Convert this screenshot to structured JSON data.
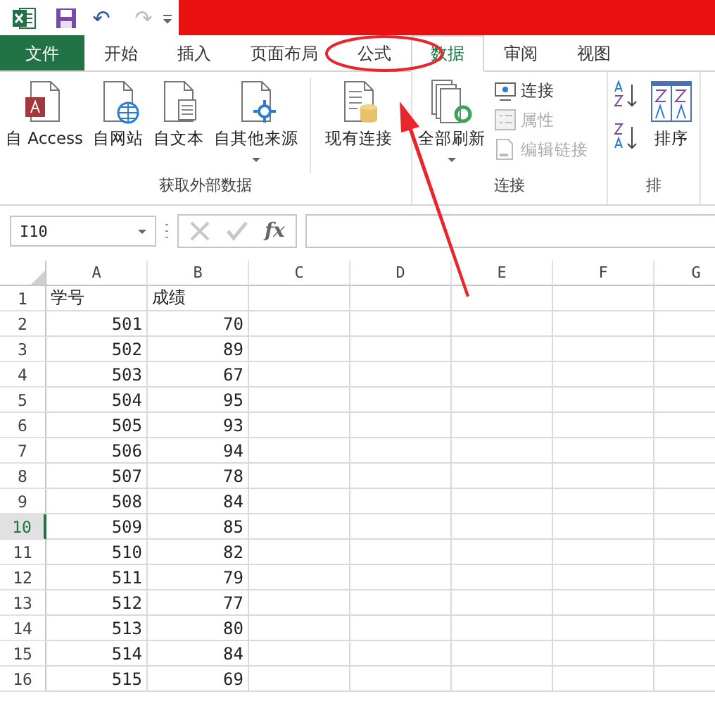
{
  "title_bar": {
    "undo": "↶",
    "redo": "↷"
  },
  "tabs": [
    {
      "label": "文件",
      "kind": "file",
      "selected": false
    },
    {
      "label": "开始",
      "kind": "tab",
      "selected": false
    },
    {
      "label": "插入",
      "kind": "tab",
      "selected": false
    },
    {
      "label": "页面布局",
      "kind": "tab",
      "selected": false
    },
    {
      "label": "公式",
      "kind": "tab",
      "selected": false
    },
    {
      "label": "数据",
      "kind": "tab",
      "selected": true
    },
    {
      "label": "审阅",
      "kind": "tab",
      "selected": false
    },
    {
      "label": "视图",
      "kind": "tab",
      "selected": false
    }
  ],
  "ribbon": {
    "groups": [
      {
        "label": "获取外部数据",
        "large": [
          {
            "label": "自 Access",
            "dropdown": false
          },
          {
            "label": "自网站",
            "dropdown": false
          },
          {
            "label": "自文本",
            "dropdown": false
          },
          {
            "label": "自其他来源",
            "dropdown": true
          },
          {
            "label": "现有连接",
            "dropdown": false
          }
        ]
      },
      {
        "label": "连接",
        "large": [
          {
            "label": "全部刷新",
            "dropdown": true
          }
        ],
        "small": [
          {
            "label": "连接",
            "disabled": false
          },
          {
            "label": "属性",
            "disabled": true
          },
          {
            "label": "编辑链接",
            "disabled": true
          }
        ]
      },
      {
        "label": "排",
        "large": [
          {
            "label": "排序",
            "dropdown": false
          }
        ]
      }
    ]
  },
  "formula_bar": {
    "name_box": "I10",
    "fx": "fx"
  },
  "sheet": {
    "columns": [
      "A",
      "B",
      "C",
      "D",
      "E",
      "F",
      "G"
    ],
    "rows": [
      {
        "number": "1",
        "selected": false,
        "cells": [
          {
            "text": "学号",
            "kind": "text"
          },
          {
            "text": "成绩",
            "kind": "text"
          }
        ]
      },
      {
        "number": "2",
        "selected": false,
        "cells": [
          {
            "text": "501",
            "kind": "number"
          },
          {
            "text": "70",
            "kind": "number"
          }
        ]
      },
      {
        "number": "3",
        "selected": false,
        "cells": [
          {
            "text": "502",
            "kind": "number"
          },
          {
            "text": "89",
            "kind": "number"
          }
        ]
      },
      {
        "number": "4",
        "selected": false,
        "cells": [
          {
            "text": "503",
            "kind": "number"
          },
          {
            "text": "67",
            "kind": "number"
          }
        ]
      },
      {
        "number": "5",
        "selected": false,
        "cells": [
          {
            "text": "504",
            "kind": "number"
          },
          {
            "text": "95",
            "kind": "number"
          }
        ]
      },
      {
        "number": "6",
        "selected": false,
        "cells": [
          {
            "text": "505",
            "kind": "number"
          },
          {
            "text": "93",
            "kind": "number"
          }
        ]
      },
      {
        "number": "7",
        "selected": false,
        "cells": [
          {
            "text": "506",
            "kind": "number"
          },
          {
            "text": "94",
            "kind": "number"
          }
        ]
      },
      {
        "number": "8",
        "selected": false,
        "cells": [
          {
            "text": "507",
            "kind": "number"
          },
          {
            "text": "78",
            "kind": "number"
          }
        ]
      },
      {
        "number": "9",
        "selected": false,
        "cells": [
          {
            "text": "508",
            "kind": "number"
          },
          {
            "text": "84",
            "kind": "number"
          }
        ]
      },
      {
        "number": "10",
        "selected": true,
        "cells": [
          {
            "text": "509",
            "kind": "number"
          },
          {
            "text": "85",
            "kind": "number"
          }
        ]
      },
      {
        "number": "11",
        "selected": false,
        "cells": [
          {
            "text": "510",
            "kind": "number"
          },
          {
            "text": "82",
            "kind": "number"
          }
        ]
      },
      {
        "number": "12",
        "selected": false,
        "cells": [
          {
            "text": "511",
            "kind": "number"
          },
          {
            "text": "79",
            "kind": "number"
          }
        ]
      },
      {
        "number": "13",
        "selected": false,
        "cells": [
          {
            "text": "512",
            "kind": "number"
          },
          {
            "text": "77",
            "kind": "number"
          }
        ]
      },
      {
        "number": "14",
        "selected": false,
        "cells": [
          {
            "text": "513",
            "kind": "number"
          },
          {
            "text": "80",
            "kind": "number"
          }
        ]
      },
      {
        "number": "15",
        "selected": false,
        "cells": [
          {
            "text": "514",
            "kind": "number"
          },
          {
            "text": "84",
            "kind": "number"
          }
        ]
      },
      {
        "number": "16",
        "selected": false,
        "cells": [
          {
            "text": "515",
            "kind": "number"
          },
          {
            "text": "69",
            "kind": "number"
          }
        ]
      }
    ]
  }
}
